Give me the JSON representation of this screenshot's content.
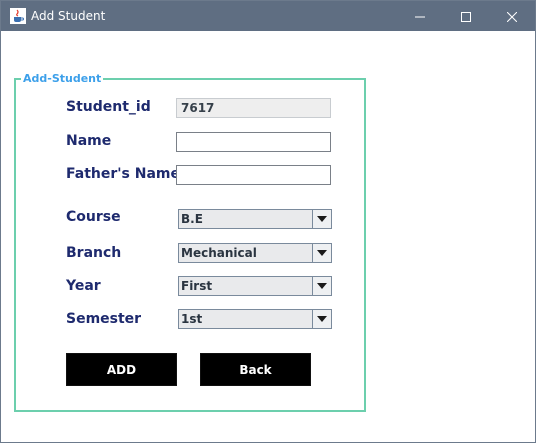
{
  "window": {
    "title": "Add Student",
    "icons": {
      "app": "java-cup-icon",
      "minimize": "minimize-icon",
      "maximize": "maximize-icon",
      "close": "close-icon"
    }
  },
  "form": {
    "legend": "Add-Student",
    "student_id": {
      "label": "Student_id",
      "value": "7617"
    },
    "name": {
      "label": "Name",
      "value": ""
    },
    "fathers_name": {
      "label": "Father's Name",
      "value": ""
    },
    "course": {
      "label": "Course",
      "selected": "B.E"
    },
    "branch": {
      "label": "Branch",
      "selected": "Mechanical"
    },
    "year": {
      "label": "Year",
      "selected": "First"
    },
    "semester": {
      "label": "Semester",
      "selected": "1st"
    },
    "buttons": {
      "add": "ADD",
      "back": "Back"
    }
  },
  "colors": {
    "titlebar": "#5f6e82",
    "legend": "#3da0ea",
    "group_border": "#6ccfad",
    "label": "#1e2a6e",
    "button_bg": "#000000"
  }
}
